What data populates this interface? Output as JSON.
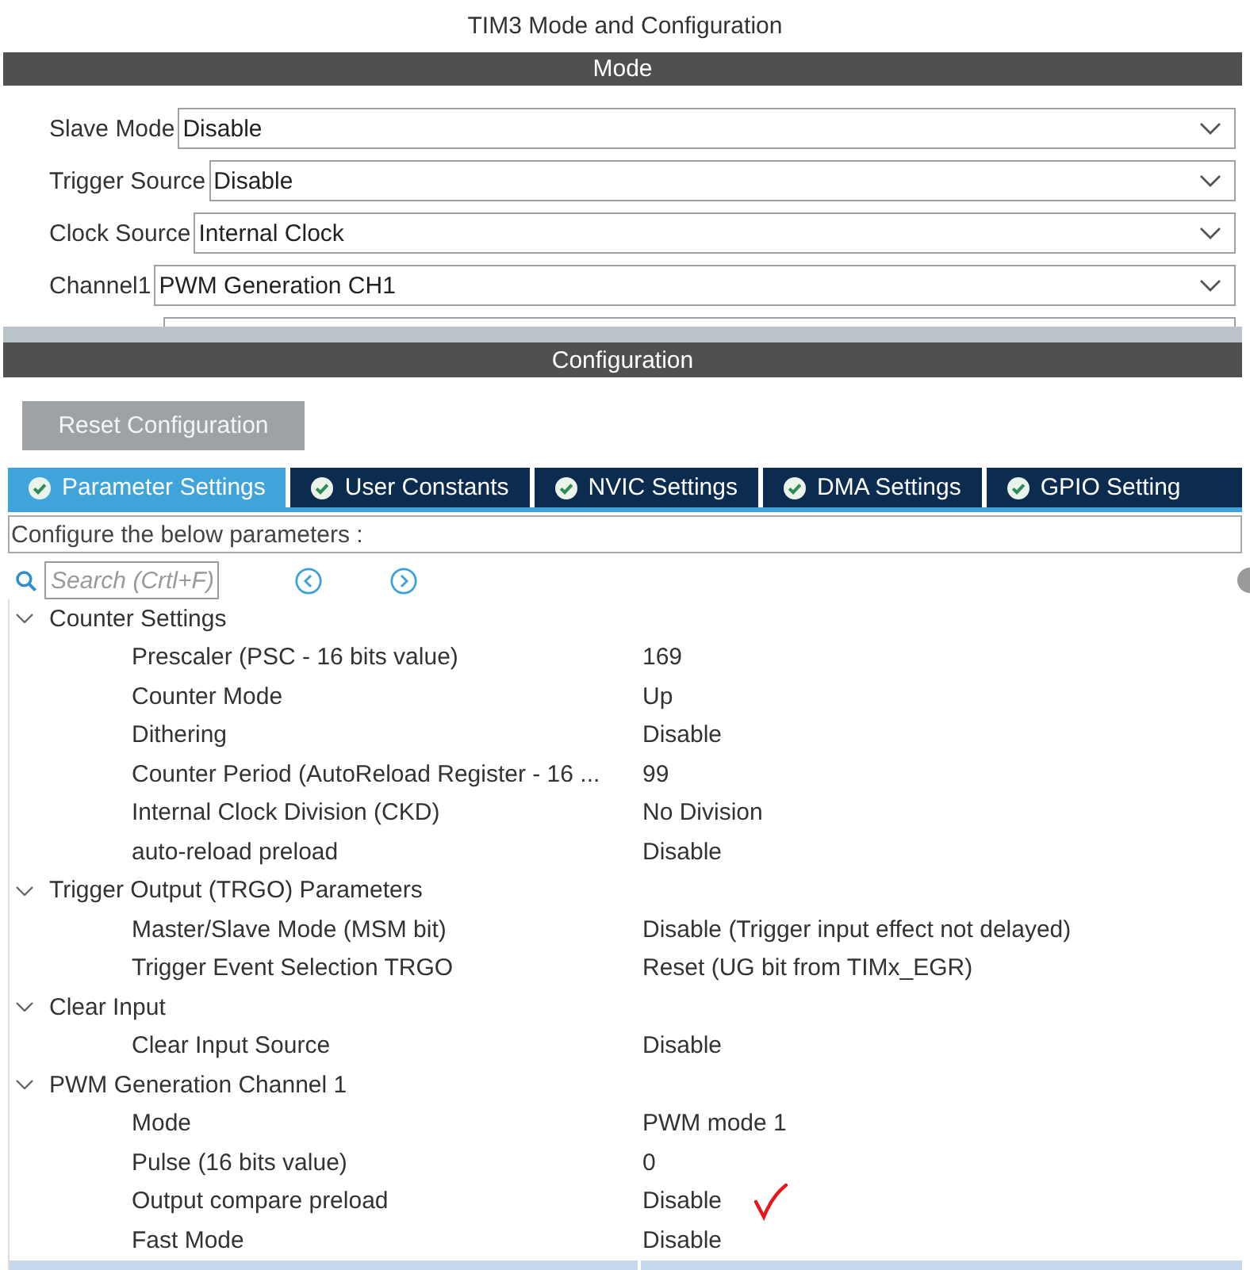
{
  "window": {
    "title": "TIM3 Mode and Configuration"
  },
  "mode": {
    "header": "Mode",
    "fields": [
      {
        "kind": "select",
        "label": "Slave Mode",
        "value": "Disable"
      },
      {
        "kind": "select",
        "label": "Trigger Source",
        "value": "Disable"
      },
      {
        "kind": "select",
        "label": "Clock Source",
        "value": "Internal Clock"
      },
      {
        "kind": "select",
        "label": "Channel1",
        "value": "PWM Generation CH1"
      },
      {
        "kind": "select"
      }
    ]
  },
  "configuration": {
    "header": "Configuration",
    "reset_button": "Reset Configuration",
    "tabs": [
      {
        "label": "Parameter Settings",
        "selected": true
      },
      {
        "label": "User Constants",
        "selected": false
      },
      {
        "label": "NVIC Settings",
        "selected": false
      },
      {
        "label": "DMA Settings",
        "selected": false
      },
      {
        "label": "GPIO Setting",
        "selected": false
      }
    ],
    "hint": "Configure the below parameters :",
    "search": {
      "placeholder": "Search (Crtl+F)"
    },
    "parameters": [
      {
        "label": "Counter Settings",
        "expanded": true,
        "children": [
          {
            "label": "Prescaler (PSC - 16 bits value)",
            "value": "169",
            "selected": false,
            "marked": false
          },
          {
            "label": "Counter Mode",
            "value": "Up",
            "selected": false,
            "marked": false
          },
          {
            "label": "Dithering",
            "value": "Disable",
            "selected": false,
            "marked": false
          },
          {
            "label": "Counter Period (AutoReload Register - 16 ...",
            "value": "99",
            "selected": false,
            "marked": false
          },
          {
            "label": "Internal Clock Division (CKD)",
            "value": "No Division",
            "selected": false,
            "marked": false
          },
          {
            "label": "auto-reload preload",
            "value": "Disable",
            "selected": false,
            "marked": false
          }
        ]
      },
      {
        "label": "Trigger Output (TRGO) Parameters",
        "expanded": true,
        "children": [
          {
            "label": "Master/Slave Mode (MSM bit)",
            "value": "Disable (Trigger input effect not delayed)",
            "selected": false,
            "marked": false
          },
          {
            "label": "Trigger Event Selection TRGO",
            "value": "Reset (UG bit from TIMx_EGR)",
            "selected": false,
            "marked": false
          }
        ]
      },
      {
        "label": "Clear Input",
        "expanded": true,
        "children": [
          {
            "label": "Clear Input Source",
            "value": "Disable",
            "selected": false,
            "marked": false
          }
        ]
      },
      {
        "label": "PWM Generation Channel 1",
        "expanded": true,
        "children": [
          {
            "label": "Mode",
            "value": "PWM mode 1",
            "selected": false,
            "marked": false
          },
          {
            "label": "Pulse (16 bits value)",
            "value": "0",
            "selected": false,
            "marked": false
          },
          {
            "label": "Output compare preload",
            "value": "Disable",
            "selected": false,
            "marked": true
          },
          {
            "label": "Fast Mode",
            "value": "Disable",
            "selected": false,
            "marked": false
          },
          {
            "selected": true,
            "marked": false
          }
        ]
      }
    ]
  }
}
